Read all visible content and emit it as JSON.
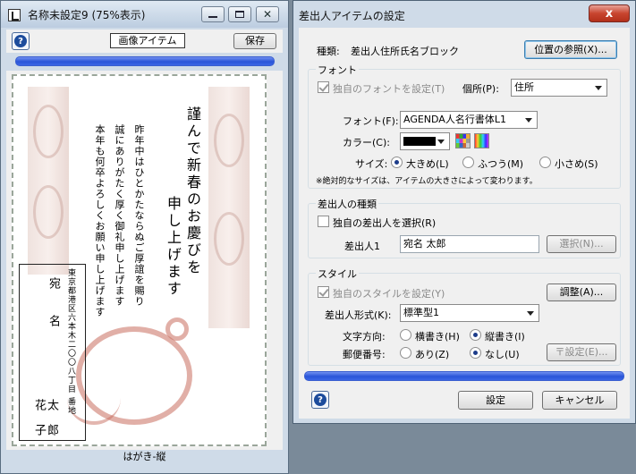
{
  "left_window": {
    "title": "名称未設定9 (75%表示)",
    "mode_label": "画像アイテム",
    "save_label": "保存",
    "help_glyph": "?",
    "status": "はがき-縦",
    "card": {
      "heading_1": "謹んで新春のお慶びを",
      "heading_2": "申し上げます",
      "message_1": "昨年中はひとかたならぬご厚誼を賜り",
      "message_2": "誠にありがたく厚く御礼申し上げます",
      "message_3": "本年も何卒よろしくお願い申し上げます",
      "address": "東京都港区六本木二〇〇八丁目 番地",
      "recipient_1": "宛",
      "recipient_2": "名",
      "recipient_3": "太",
      "recipient_4": "郎",
      "signer_1": "花",
      "signer_2": "子"
    }
  },
  "dialog": {
    "title": "差出人アイテムの設定",
    "close_glyph": "x",
    "kind_label": "種類:",
    "kind_value": "差出人住所氏名ブロック",
    "ref_button": "位置の参照(X)...",
    "font_group": "フォント",
    "own_font_label": "独自のフォントを設定(T)",
    "location_label": "個所(P):",
    "location_value": "住所",
    "font_label": "フォント(F):",
    "font_value": "AGENDA人名行書体L1",
    "color_label": "カラー(C):",
    "size_label": "サイズ:",
    "size_large": "大きめ(L)",
    "size_normal": "ふつう(M)",
    "size_small": "小さめ(S)",
    "size_note": "※絶対的なサイズは、アイテムの大きさによって変わります。",
    "sender_group": "差出人の種類",
    "own_sender_label": "独自の差出人を選択(R)",
    "sender_label": "差出人1",
    "sender_value": "宛名 太郎",
    "select_button": "選択(N)...",
    "style_group": "スタイル",
    "own_style_label": "独自のスタイルを設定(Y)",
    "adjust_button": "調整(A)...",
    "format_label": "差出人形式(K):",
    "format_value": "標準型1",
    "direction_label": "文字方向:",
    "dir_horizontal": "横書き(H)",
    "dir_vertical": "縦書き(I)",
    "postal_label": "郵便番号:",
    "postal_yes": "あり(Z)",
    "postal_no": "なし(U)",
    "postal_button": "〒設定(E)...",
    "help_glyph": "?",
    "ok_button": "設定",
    "cancel_button": "キャンセル"
  },
  "colors": {
    "progress": "#2a55d8",
    "close": "#c8452f",
    "text_color_swatch": "#000000"
  }
}
